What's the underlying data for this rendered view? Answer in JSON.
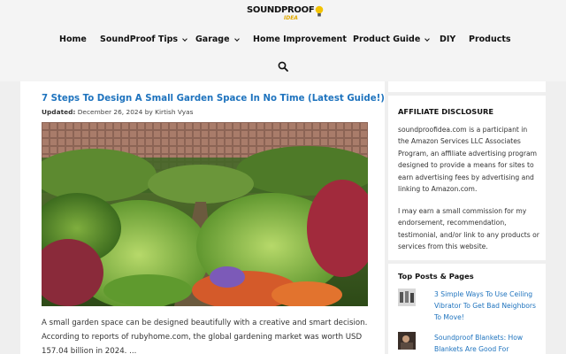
{
  "site": {
    "logo_text": "SOUNDPROOF",
    "logo_sub": "IDEA",
    "icons": {
      "logo": "lightbulb-icon",
      "search": "search-icon",
      "dropdown": "chevron-down-icon"
    },
    "colors": {
      "link": "#1e73be",
      "bulb": "#f2c200"
    }
  },
  "nav": {
    "items": [
      {
        "label": "Home",
        "has_dropdown": false
      },
      {
        "label": "SoundProof Tips",
        "has_dropdown": true
      },
      {
        "label": "Garage",
        "has_dropdown": true
      },
      {
        "label": "Home Improvement",
        "has_dropdown": false
      },
      {
        "label": "Product Guide",
        "has_dropdown": true
      },
      {
        "label": "DIY",
        "has_dropdown": false
      },
      {
        "label": "Products",
        "has_dropdown": false
      }
    ]
  },
  "article": {
    "title": "7 Steps To Design A Small Garden Space In No Time (Latest Guide!)",
    "updated_label": "Updated:",
    "date": "December 26, 2024",
    "by": "by",
    "author": "Kirtish Vyas",
    "excerpt": "A small garden space can be designed beautifully with a creative and smart decision. According to reports of rubyhome.com, the global gardening market was worth USD 157.04 billion in 2024.  ..."
  },
  "sidebar": {
    "disclosure_title": "AFFILIATE DISCLOSURE",
    "disclosure_p1": "soundproofidea.com is a participant in the Amazon Services LLC Associates Program, an affiliate advertising program designed to provide a means for sites to earn advertising fees by advertising and linking to Amazon.com.",
    "disclosure_p2": "I may earn a small commission for my endorsement, recommendation, testimonial, and/or link to any products or services from this website.",
    "top_posts_title": "Top Posts & Pages",
    "top_posts": [
      {
        "title": "3 Simple Ways To Use Ceiling Vibrator To Get Bad Neighbors To Move!"
      },
      {
        "title": "Soundproof Blankets: How Blankets Are Good For"
      }
    ]
  }
}
